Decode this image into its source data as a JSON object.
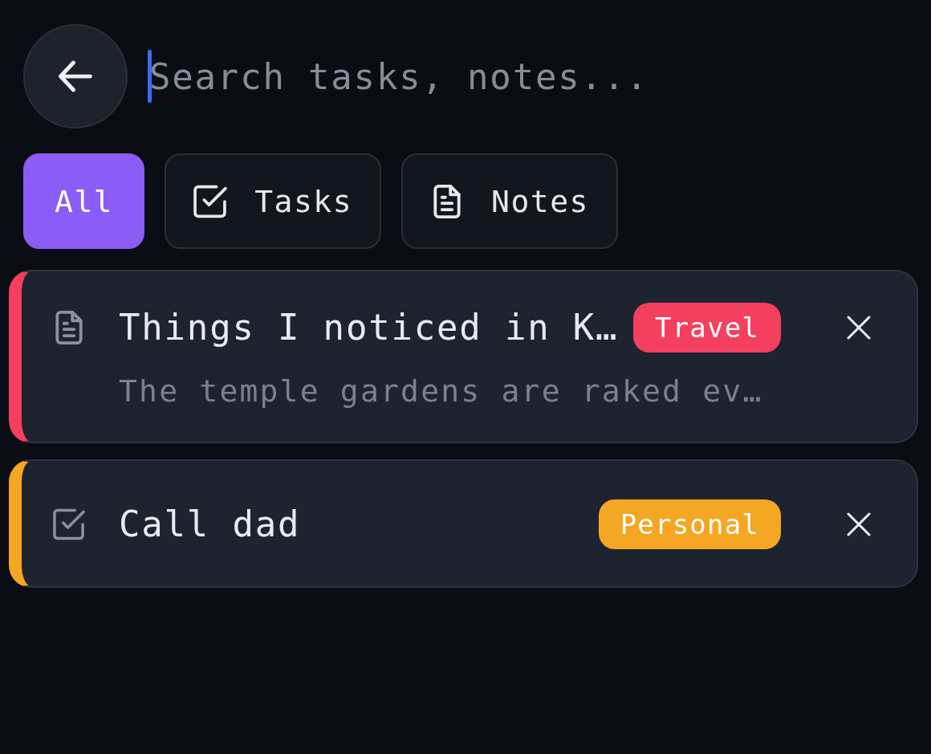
{
  "search": {
    "placeholder": "Search tasks, notes..."
  },
  "filters": [
    {
      "label": "All",
      "kind": "all",
      "selected": true
    },
    {
      "label": "Tasks",
      "kind": "tasks",
      "selected": false
    },
    {
      "label": "Notes",
      "kind": "notes",
      "selected": false
    }
  ],
  "items": [
    {
      "kind": "note",
      "title": "Things I noticed in K…",
      "preview": "The temple gardens are raked ev…",
      "tag": "Travel",
      "color": "#f43f5e"
    },
    {
      "kind": "task",
      "title": "Call dad",
      "tag": "Personal",
      "color": "#f5a623"
    }
  ]
}
